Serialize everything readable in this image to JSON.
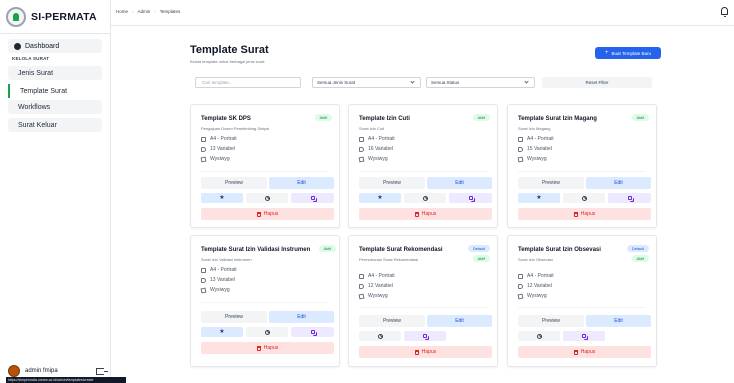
{
  "app": {
    "name": "SI-PERMATA"
  },
  "sidebar": {
    "dashboard_label": "Dashboard",
    "section_label": "KELOLA SURAT",
    "items": [
      {
        "label": "Jenis Surat"
      },
      {
        "label": "Template Surat"
      },
      {
        "label": "Workflows"
      },
      {
        "label": "Surat Keluar"
      }
    ],
    "active_item": "Template Surat",
    "accent_color": "#16a34a"
  },
  "user": {
    "name": "admin fmipa"
  },
  "status_url": "https://simpermata.unram.ac.id/admin/templates/create",
  "breadcrumb": [
    "Home",
    "Admin",
    "Templates"
  ],
  "page": {
    "title": "Template Surat",
    "subtitle": "Kelola template untuk berbagai jenis surat",
    "add_button": "Buat Template Baru"
  },
  "filters": {
    "search_placeholder": "Cari template...",
    "jenis_value": "Semua Jenis Surat",
    "status_value": "Semua Status",
    "reset_label": "Reset Filter"
  },
  "labels": {
    "preview": "Preview",
    "edit": "Edit",
    "hapus": "Hapus"
  },
  "cards": [
    {
      "title": "Template SK DPS",
      "description": "Pengajuan Dosen Pembimbing Skripsi",
      "badges": [
        "Aktif"
      ],
      "paper": "A4 - Portrait",
      "variables": "13 Variabel",
      "editor": "Wysiwyg"
    },
    {
      "title": "Template Izin Cuti",
      "description": "Surat Izin Cuti",
      "badges": [
        "Aktif"
      ],
      "paper": "A4 - Portrait",
      "variables": "16 Variabel",
      "editor": "Wysiwyg"
    },
    {
      "title": "Template Surat Izin Magang",
      "description": "Surat Izin Magang",
      "badges": [
        "Aktif"
      ],
      "paper": "A4 - Portrait",
      "variables": "15 Variabel",
      "editor": "Wysiwyg"
    },
    {
      "title": "Template Surat Izin Validasi Instrumen",
      "description": "Surat Izin Validasi Instrumen",
      "badges": [
        "Aktif"
      ],
      "paper": "A4 - Portrait",
      "variables": "13 Variabel",
      "editor": "Wysiwyg"
    },
    {
      "title": "Template Surat Rekomendasi",
      "description": "Permohonan Surat Rekomendasi",
      "badges": [
        "Default",
        "Aktif"
      ],
      "paper": "A4 - Portrait",
      "variables": "12 Variabel",
      "editor": "Wysiwyg"
    },
    {
      "title": "Template Surat Izin Obsevasi",
      "description": "Surat Izin Obsevasi",
      "badges": [
        "Default",
        "Aktif"
      ],
      "paper": "A4 - Portrait",
      "variables": "12 Variabel",
      "editor": "Wysiwyg"
    }
  ],
  "colors": {
    "primary": "#2563eb",
    "aktif_badge": "#dcfce7",
    "default_badge": "#dbeafe",
    "hapus": "#fee2e2"
  }
}
